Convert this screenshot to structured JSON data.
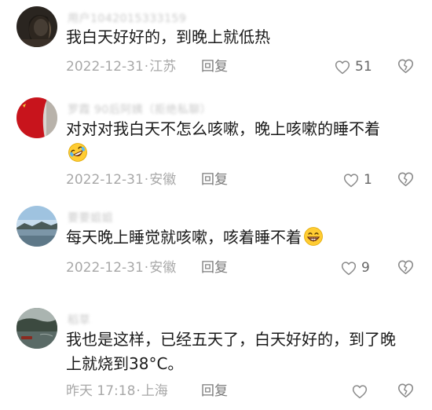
{
  "comments": [
    {
      "username": "用户1042015333159",
      "text": "我白天好好的，到晚上就低热",
      "date": "2022-12-31",
      "location": "江苏",
      "reply_label": "回复",
      "likes": "51",
      "has_emoji": false,
      "avatar_icon": "dark-portrait-avatar-icon"
    },
    {
      "username": "罗霞 90后阿姨（拒绝私聊）",
      "text": "对对对我白天不怎么咳嗽，晚上咳嗽的睡不着",
      "date": "2022-12-31",
      "location": "安徽",
      "reply_label": "回复",
      "likes": "1",
      "has_emoji": true,
      "emoji_icon": "rolling-laughing-emoji-icon",
      "avatar_icon": "red-flag-avatar-icon"
    },
    {
      "username": "要要姐姐",
      "text": "每天晚上睡觉就咳嗽，咳着睡不着",
      "date": "2022-12-31",
      "location": "安徽",
      "reply_label": "回复",
      "likes": "9",
      "has_emoji": true,
      "emoji_icon": "grinning-emoji-icon",
      "avatar_icon": "landscape-avatar-icon"
    },
    {
      "username": "稻草",
      "text": "我也是这样，已经五天了，白天好好的，到了晚上就烧到38°C。",
      "date": "昨天 17:18",
      "location": "上海",
      "reply_label": "回复",
      "likes": "",
      "has_emoji": false,
      "avatar_icon": "lake-photo-avatar-icon"
    }
  ],
  "icons": {
    "like": "heart-outline-icon",
    "dislike": "broken-heart-outline-icon"
  },
  "colors": {
    "text": "#1a1a1a",
    "meta": "#a8a8a8",
    "reply": "#7a7a7a",
    "icon_stroke": "#8a8a8a"
  }
}
